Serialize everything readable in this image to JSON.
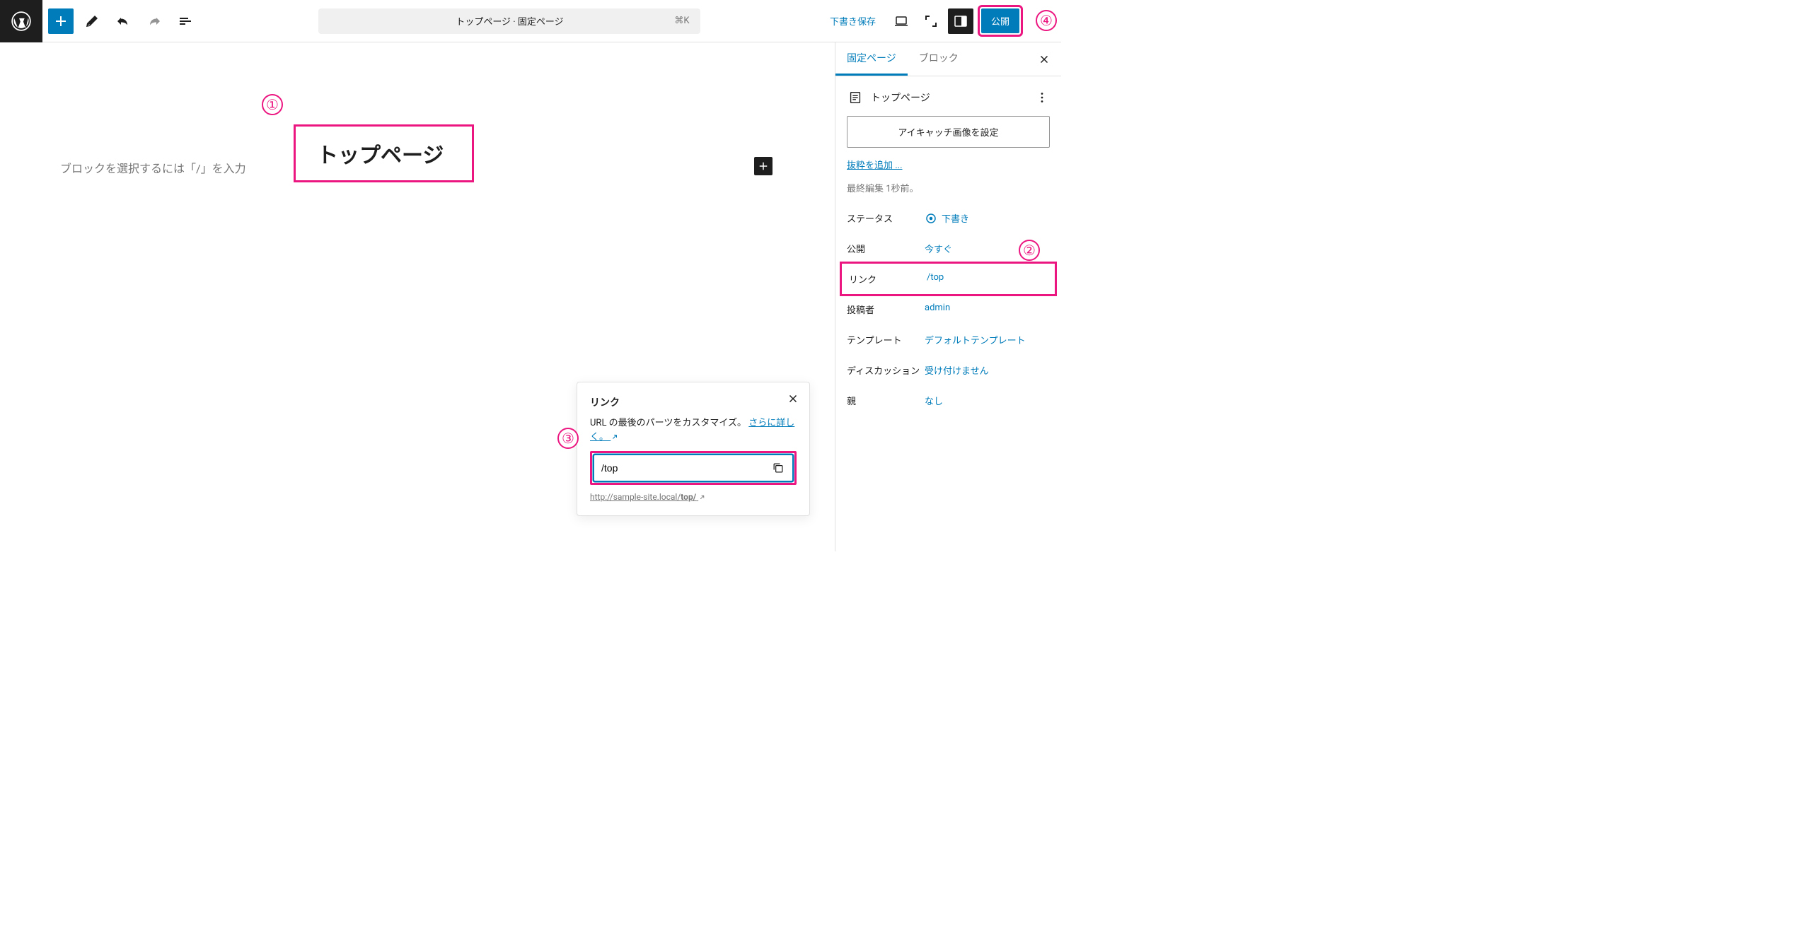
{
  "toolbar": {
    "doc_title": "トップページ · 固定ページ",
    "shortcut": "⌘K",
    "save_draft": "下書き保存",
    "publish": "公開"
  },
  "editor": {
    "page_title": "トップページ",
    "block_placeholder": "ブロックを選択するには「/」を入力"
  },
  "sidebar": {
    "tabs": {
      "page": "固定ページ",
      "block": "ブロック"
    },
    "summary_title": "トップページ",
    "featured_image": "アイキャッチ画像を設定",
    "add_excerpt": "抜粋を追加 ...",
    "last_edit": "最終編集 1秒前。",
    "rows": {
      "status": {
        "label": "ステータス",
        "value": "下書き"
      },
      "publish": {
        "label": "公開",
        "value": "今すぐ"
      },
      "link": {
        "label": "リンク",
        "value": "/top"
      },
      "author": {
        "label": "投稿者",
        "value": "admin"
      },
      "template": {
        "label": "テンプレート",
        "value": "デフォルトテンプレート"
      },
      "discussion": {
        "label": "ディスカッション",
        "value": "受け付けません"
      },
      "parent": {
        "label": "親",
        "value": "なし"
      }
    }
  },
  "link_popover": {
    "title": "リンク",
    "desc_prefix": "URL の最後のパーツをカスタマイズ。",
    "desc_link": "さらに詳しく。",
    "slug_value": "/top",
    "permalink_base": "http://sample-site.local/",
    "permalink_slug": "top/"
  },
  "annotations": {
    "a1": "①",
    "a2": "②",
    "a3": "③",
    "a4": "④"
  }
}
